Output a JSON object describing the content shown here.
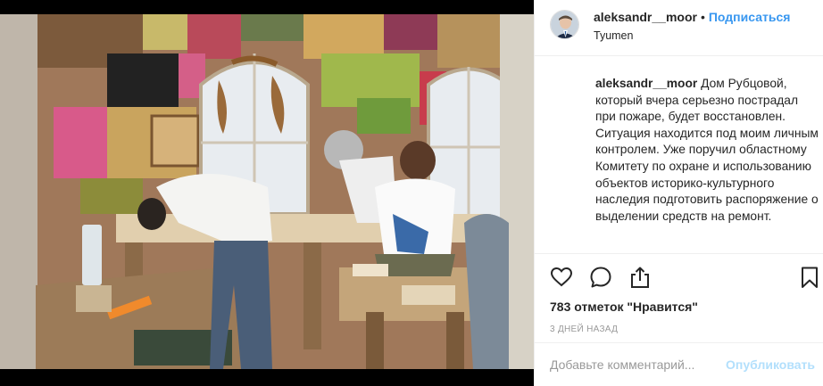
{
  "header": {
    "username": "aleksandr__moor",
    "separator": "•",
    "follow_label": "Подписаться",
    "location": "Tyumen"
  },
  "caption": {
    "username": "aleksandr__moor",
    "text": "Дом Рубцовой, который вчера серьезно пострадал при пожаре, будет восстановлен. Ситуация находится под моим личным контролем. Уже поручил областному Комитету по охране и использованию объектов историко-культурного наследия подготовить распоряжение о выделении средств на ремонт."
  },
  "actions": {
    "like_icon": "heart-icon",
    "comment_icon": "comment-icon",
    "share_icon": "share-icon",
    "save_icon": "bookmark-icon"
  },
  "likes": "783 отметок \"Нравится\"",
  "time_ago": "3 ДНЕЙ НАЗАД",
  "comment_box": {
    "placeholder": "Добавьте комментарий...",
    "post_label": "Опубликовать"
  },
  "colors": {
    "accent": "#3897f0",
    "post_disabled": "#b2dffc",
    "muted": "#999999"
  }
}
